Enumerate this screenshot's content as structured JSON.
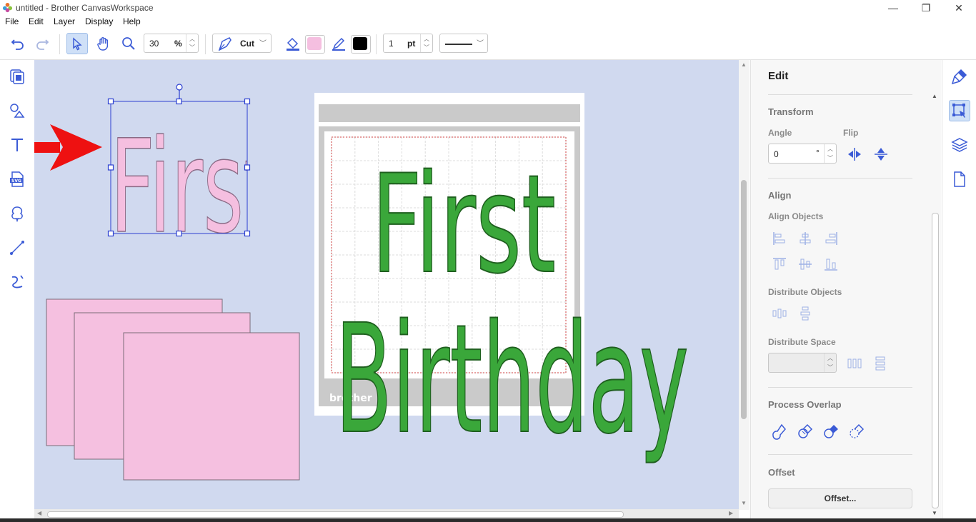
{
  "window": {
    "title": "untitled - Brother CanvasWorkspace",
    "minimize": "—",
    "restore": "❐",
    "close": "✕"
  },
  "menu": [
    "File",
    "Edit",
    "Layer",
    "Display",
    "Help"
  ],
  "toolbar": {
    "zoom_value": "30",
    "zoom_unit": "%",
    "mode_label": "Cut",
    "fill_color": "#f5bfe0",
    "line_color": "#000000",
    "line_width_value": "1",
    "line_width_unit": "pt",
    "line_style": "solid"
  },
  "canvas": {
    "background": "#d0d9ef",
    "mat_brand": "brother",
    "objects": {
      "selected_text": "First",
      "text_line1": "First",
      "text_line2": "Birthday",
      "fill_pink": "#f5bfe0",
      "fill_green": "#3aa73a"
    }
  },
  "panel": {
    "title": "Edit",
    "transform": {
      "heading": "Transform",
      "angle_label": "Angle",
      "angle_value": "0",
      "angle_unit": "°",
      "flip_label": "Flip"
    },
    "align": {
      "heading": "Align",
      "align_objects_label": "Align Objects",
      "distribute_objects_label": "Distribute Objects",
      "distribute_space_label": "Distribute Space"
    },
    "process_overlap": {
      "heading": "Process Overlap"
    },
    "offset": {
      "heading": "Offset",
      "button_label": "Offset..."
    }
  },
  "colors": {
    "accent": "#3b5bd6",
    "arrow": "#ee1111",
    "selection": "#2b3fd1"
  }
}
